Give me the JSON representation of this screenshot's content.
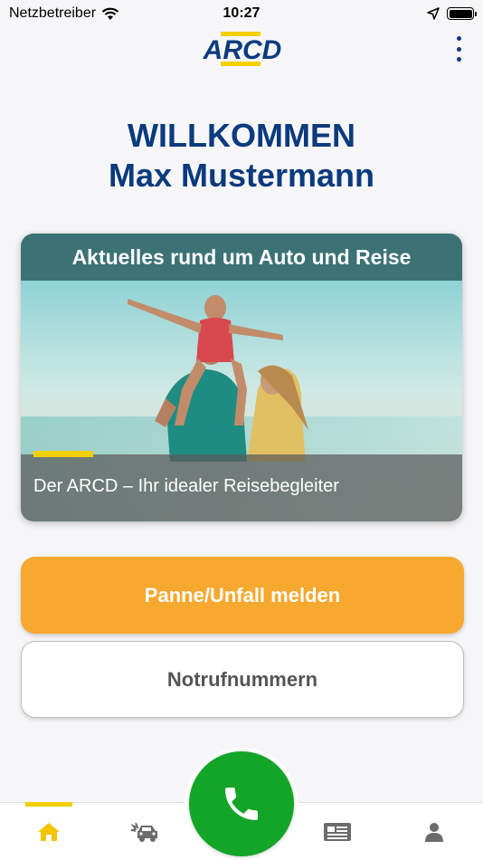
{
  "status_bar": {
    "carrier": "Netzbetreiber",
    "time": "10:27"
  },
  "header": {
    "logo_text": "ARCD",
    "brand_blue": "#0b3a7e",
    "brand_yellow": "#f3d000"
  },
  "welcome": {
    "line1": "WILLKOMMEN",
    "line2": "Max Mustermann"
  },
  "news_card": {
    "title": "Aktuelles rund um Auto und Reise",
    "caption": "Der ARCD – Ihr idealer Reisebegleiter",
    "image_icon": "family-beach-photo"
  },
  "actions": {
    "panne_label": "Panne/Unfall melden",
    "panne_color": "#f6a82f",
    "notruf_label": "Notrufnummern"
  },
  "tabbar": {
    "items": [
      {
        "name": "home",
        "icon": "home-icon",
        "active": true
      },
      {
        "name": "car-accident",
        "icon": "car-accident-icon",
        "active": false
      },
      {
        "name": "call",
        "icon": "phone-icon",
        "active": false
      },
      {
        "name": "news",
        "icon": "newspaper-icon",
        "active": false
      },
      {
        "name": "profile",
        "icon": "person-icon",
        "active": false
      }
    ],
    "call_color": "#12a528",
    "active_color": "#f3d000"
  }
}
